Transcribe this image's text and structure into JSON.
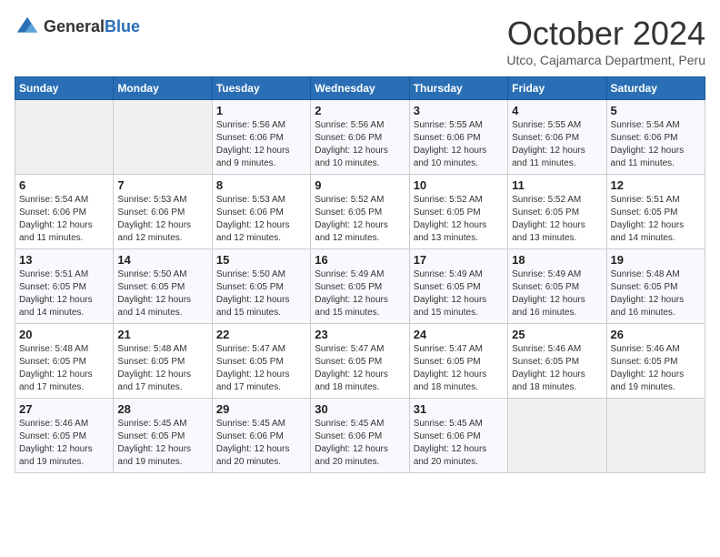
{
  "header": {
    "logo_general": "General",
    "logo_blue": "Blue",
    "month_title": "October 2024",
    "location": "Utco, Cajamarca Department, Peru"
  },
  "calendar": {
    "days_of_week": [
      "Sunday",
      "Monday",
      "Tuesday",
      "Wednesday",
      "Thursday",
      "Friday",
      "Saturday"
    ],
    "weeks": [
      [
        {
          "day": "",
          "sunrise": "",
          "sunset": "",
          "daylight": ""
        },
        {
          "day": "",
          "sunrise": "",
          "sunset": "",
          "daylight": ""
        },
        {
          "day": "1",
          "sunrise": "Sunrise: 5:56 AM",
          "sunset": "Sunset: 6:06 PM",
          "daylight": "Daylight: 12 hours and 9 minutes."
        },
        {
          "day": "2",
          "sunrise": "Sunrise: 5:56 AM",
          "sunset": "Sunset: 6:06 PM",
          "daylight": "Daylight: 12 hours and 10 minutes."
        },
        {
          "day": "3",
          "sunrise": "Sunrise: 5:55 AM",
          "sunset": "Sunset: 6:06 PM",
          "daylight": "Daylight: 12 hours and 10 minutes."
        },
        {
          "day": "4",
          "sunrise": "Sunrise: 5:55 AM",
          "sunset": "Sunset: 6:06 PM",
          "daylight": "Daylight: 12 hours and 11 minutes."
        },
        {
          "day": "5",
          "sunrise": "Sunrise: 5:54 AM",
          "sunset": "Sunset: 6:06 PM",
          "daylight": "Daylight: 12 hours and 11 minutes."
        }
      ],
      [
        {
          "day": "6",
          "sunrise": "Sunrise: 5:54 AM",
          "sunset": "Sunset: 6:06 PM",
          "daylight": "Daylight: 12 hours and 11 minutes."
        },
        {
          "day": "7",
          "sunrise": "Sunrise: 5:53 AM",
          "sunset": "Sunset: 6:06 PM",
          "daylight": "Daylight: 12 hours and 12 minutes."
        },
        {
          "day": "8",
          "sunrise": "Sunrise: 5:53 AM",
          "sunset": "Sunset: 6:06 PM",
          "daylight": "Daylight: 12 hours and 12 minutes."
        },
        {
          "day": "9",
          "sunrise": "Sunrise: 5:52 AM",
          "sunset": "Sunset: 6:05 PM",
          "daylight": "Daylight: 12 hours and 12 minutes."
        },
        {
          "day": "10",
          "sunrise": "Sunrise: 5:52 AM",
          "sunset": "Sunset: 6:05 PM",
          "daylight": "Daylight: 12 hours and 13 minutes."
        },
        {
          "day": "11",
          "sunrise": "Sunrise: 5:52 AM",
          "sunset": "Sunset: 6:05 PM",
          "daylight": "Daylight: 12 hours and 13 minutes."
        },
        {
          "day": "12",
          "sunrise": "Sunrise: 5:51 AM",
          "sunset": "Sunset: 6:05 PM",
          "daylight": "Daylight: 12 hours and 14 minutes."
        }
      ],
      [
        {
          "day": "13",
          "sunrise": "Sunrise: 5:51 AM",
          "sunset": "Sunset: 6:05 PM",
          "daylight": "Daylight: 12 hours and 14 minutes."
        },
        {
          "day": "14",
          "sunrise": "Sunrise: 5:50 AM",
          "sunset": "Sunset: 6:05 PM",
          "daylight": "Daylight: 12 hours and 14 minutes."
        },
        {
          "day": "15",
          "sunrise": "Sunrise: 5:50 AM",
          "sunset": "Sunset: 6:05 PM",
          "daylight": "Daylight: 12 hours and 15 minutes."
        },
        {
          "day": "16",
          "sunrise": "Sunrise: 5:49 AM",
          "sunset": "Sunset: 6:05 PM",
          "daylight": "Daylight: 12 hours and 15 minutes."
        },
        {
          "day": "17",
          "sunrise": "Sunrise: 5:49 AM",
          "sunset": "Sunset: 6:05 PM",
          "daylight": "Daylight: 12 hours and 15 minutes."
        },
        {
          "day": "18",
          "sunrise": "Sunrise: 5:49 AM",
          "sunset": "Sunset: 6:05 PM",
          "daylight": "Daylight: 12 hours and 16 minutes."
        },
        {
          "day": "19",
          "sunrise": "Sunrise: 5:48 AM",
          "sunset": "Sunset: 6:05 PM",
          "daylight": "Daylight: 12 hours and 16 minutes."
        }
      ],
      [
        {
          "day": "20",
          "sunrise": "Sunrise: 5:48 AM",
          "sunset": "Sunset: 6:05 PM",
          "daylight": "Daylight: 12 hours and 17 minutes."
        },
        {
          "day": "21",
          "sunrise": "Sunrise: 5:48 AM",
          "sunset": "Sunset: 6:05 PM",
          "daylight": "Daylight: 12 hours and 17 minutes."
        },
        {
          "day": "22",
          "sunrise": "Sunrise: 5:47 AM",
          "sunset": "Sunset: 6:05 PM",
          "daylight": "Daylight: 12 hours and 17 minutes."
        },
        {
          "day": "23",
          "sunrise": "Sunrise: 5:47 AM",
          "sunset": "Sunset: 6:05 PM",
          "daylight": "Daylight: 12 hours and 18 minutes."
        },
        {
          "day": "24",
          "sunrise": "Sunrise: 5:47 AM",
          "sunset": "Sunset: 6:05 PM",
          "daylight": "Daylight: 12 hours and 18 minutes."
        },
        {
          "day": "25",
          "sunrise": "Sunrise: 5:46 AM",
          "sunset": "Sunset: 6:05 PM",
          "daylight": "Daylight: 12 hours and 18 minutes."
        },
        {
          "day": "26",
          "sunrise": "Sunrise: 5:46 AM",
          "sunset": "Sunset: 6:05 PM",
          "daylight": "Daylight: 12 hours and 19 minutes."
        }
      ],
      [
        {
          "day": "27",
          "sunrise": "Sunrise: 5:46 AM",
          "sunset": "Sunset: 6:05 PM",
          "daylight": "Daylight: 12 hours and 19 minutes."
        },
        {
          "day": "28",
          "sunrise": "Sunrise: 5:45 AM",
          "sunset": "Sunset: 6:05 PM",
          "daylight": "Daylight: 12 hours and 19 minutes."
        },
        {
          "day": "29",
          "sunrise": "Sunrise: 5:45 AM",
          "sunset": "Sunset: 6:06 PM",
          "daylight": "Daylight: 12 hours and 20 minutes."
        },
        {
          "day": "30",
          "sunrise": "Sunrise: 5:45 AM",
          "sunset": "Sunset: 6:06 PM",
          "daylight": "Daylight: 12 hours and 20 minutes."
        },
        {
          "day": "31",
          "sunrise": "Sunrise: 5:45 AM",
          "sunset": "Sunset: 6:06 PM",
          "daylight": "Daylight: 12 hours and 20 minutes."
        },
        {
          "day": "",
          "sunrise": "",
          "sunset": "",
          "daylight": ""
        },
        {
          "day": "",
          "sunrise": "",
          "sunset": "",
          "daylight": ""
        }
      ]
    ]
  }
}
